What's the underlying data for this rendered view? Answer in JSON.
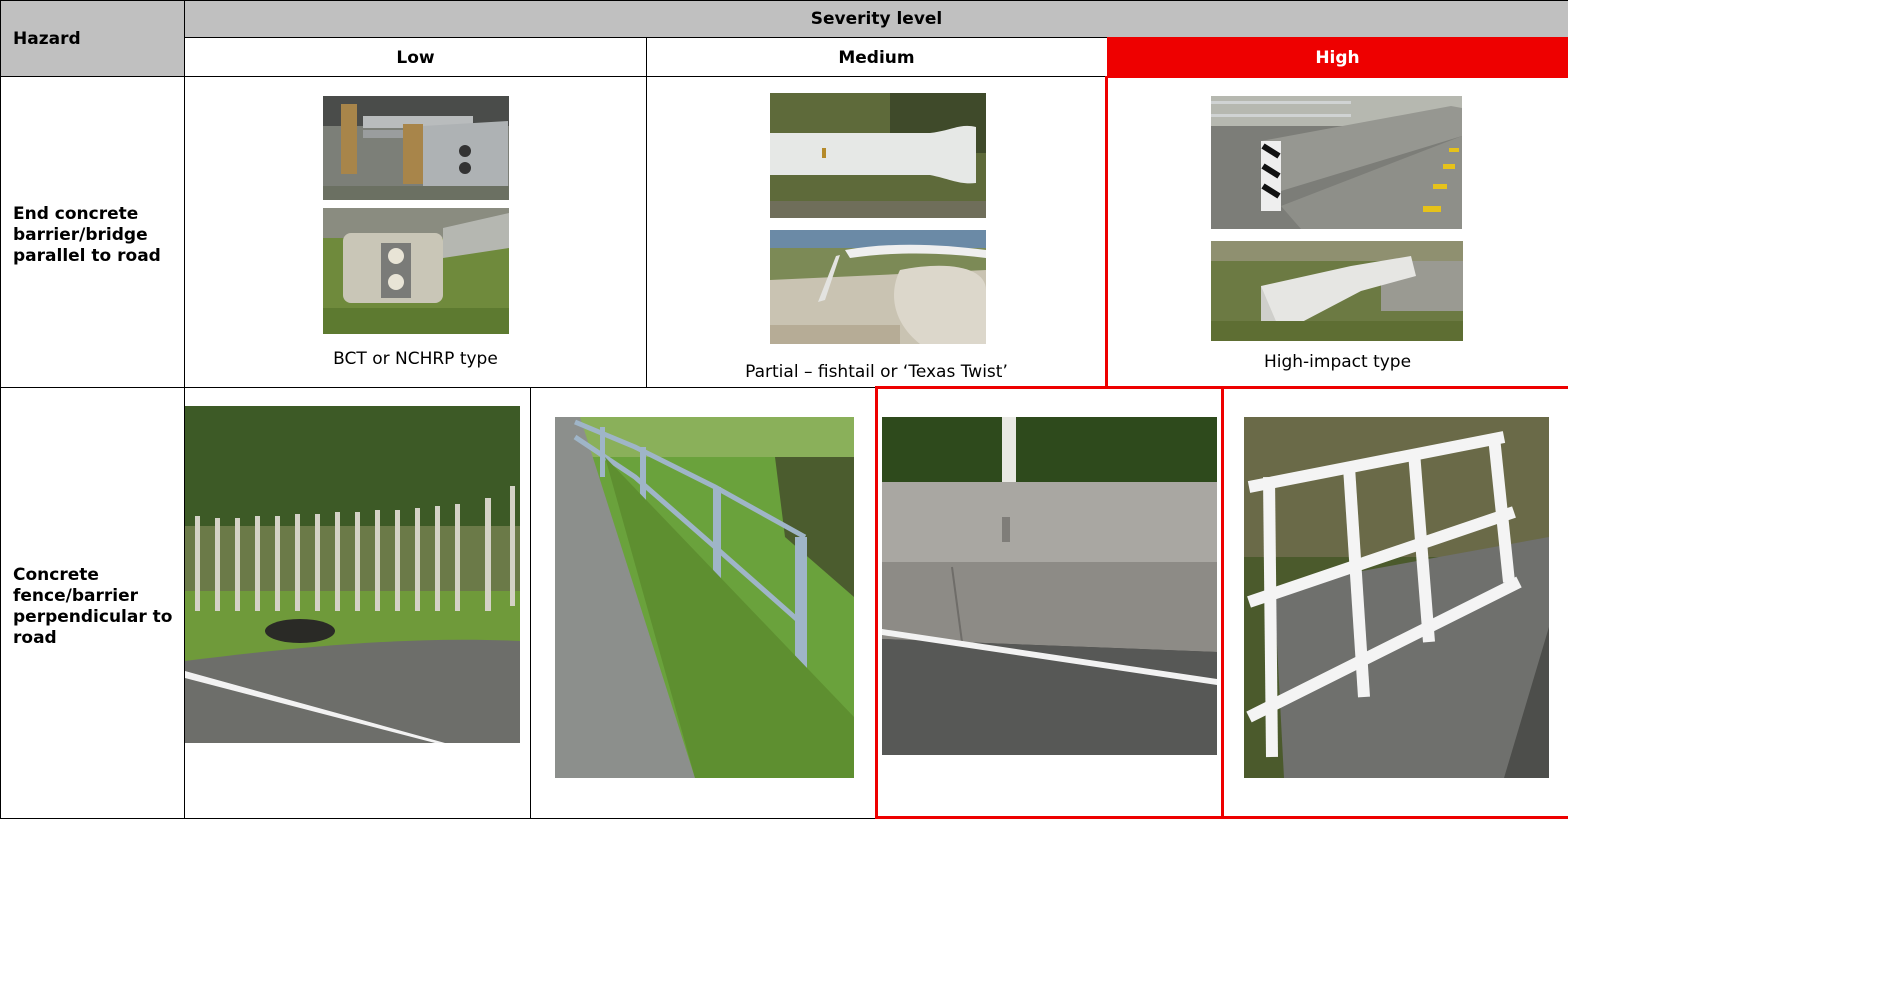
{
  "table": {
    "hazard_header": "Hazard",
    "severity_header": "Severity level",
    "levels": {
      "low": "Low",
      "medium": "Medium",
      "high": "High"
    },
    "accent_color": "#ee0000",
    "header_fill": "#c0c0c0"
  },
  "rows": [
    {
      "hazard": "End concrete barrier/bridge parallel to road",
      "low_caption": "BCT or NCHRP type",
      "medium_caption": "Partial – fishtail or ‘Texas Twist’",
      "high_caption": "High-impact type"
    },
    {
      "hazard": "Concrete fence/barrier perpendicular to road"
    }
  ]
}
